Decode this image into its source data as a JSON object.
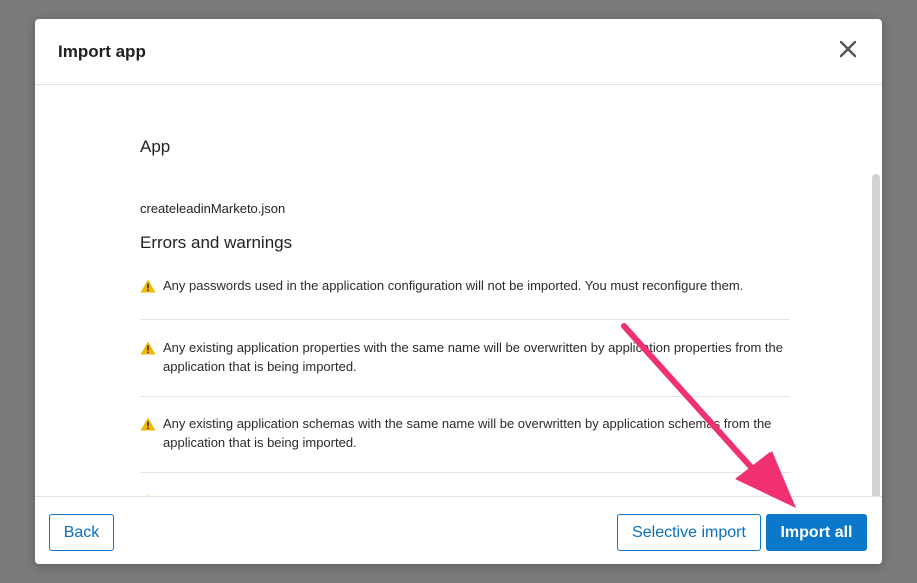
{
  "dialog": {
    "title": "Import app",
    "close_icon": "close-icon"
  },
  "body": {
    "app_heading": "App",
    "filename": "createleadinMarketo.json",
    "errors_heading": "Errors and warnings",
    "warnings": [
      "Any passwords used in the application configuration will not be imported. You must reconfigure them.",
      "Any existing application properties with the same name will be overwritten by application properties from the application that is being imported.",
      "Any existing application schemas with the same name will be overwritten by application schemas from the application that is being imported."
    ],
    "warning_icon": "warning-icon",
    "warning_color": "#f2b705"
  },
  "footer": {
    "back_label": "Back",
    "selective_label": "Selective import",
    "import_all_label": "Import all"
  },
  "annotation": {
    "arrow_color": "#f0306f"
  },
  "colors": {
    "primary": "#0b78cc",
    "overlay": "#7a7a7a"
  }
}
